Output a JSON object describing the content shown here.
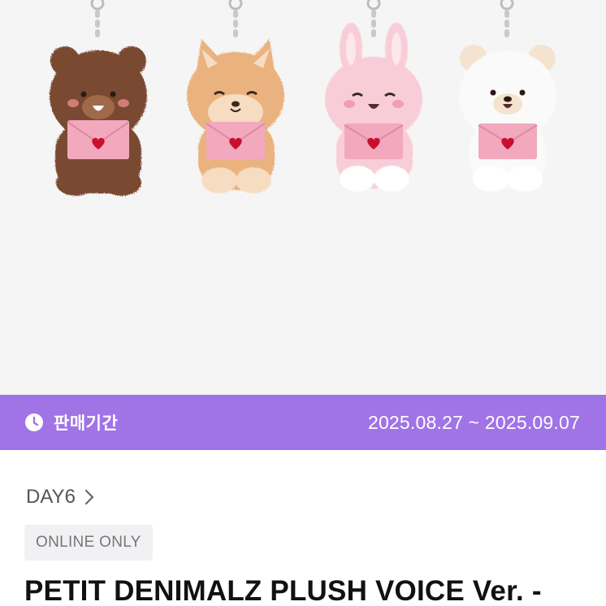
{
  "hero": {
    "characters": [
      {
        "name": "bear",
        "fur": "#7a4a30",
        "inner": "#a0694a"
      },
      {
        "name": "fox",
        "fur": "#eab27e",
        "inner": "#f6dcc0"
      },
      {
        "name": "bunny",
        "fur": "#f8cdd8",
        "inner": "#fde6ec"
      },
      {
        "name": "white-bear",
        "fur": "#fafafa",
        "inner": "#f3e3cf"
      }
    ],
    "envelope_color": "#f2a9bd",
    "heart_color": "#c8102e"
  },
  "sale": {
    "label": "판매기간",
    "dates": "2025.08.27 ~ 2025.09.07",
    "bar_color": "#a073e6"
  },
  "product": {
    "artist": "DAY6",
    "badge": "ONLINE ONLY",
    "title": "PETIT DENIMALZ PLUSH VOICE Ver. -"
  }
}
